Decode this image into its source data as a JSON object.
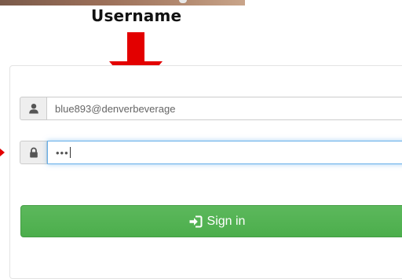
{
  "annotation": {
    "label": "Username",
    "arrow_color": "#e30000"
  },
  "login_form": {
    "username_value": "blue893@denverbeverage",
    "password_mask": "•••",
    "username_icon": "user-icon",
    "password_icon": "lock-icon",
    "signin_icon": "sign-in-icon",
    "signin_label": "Sign in",
    "button_color": "#5cb85c",
    "focus_color": "#66afe9"
  }
}
